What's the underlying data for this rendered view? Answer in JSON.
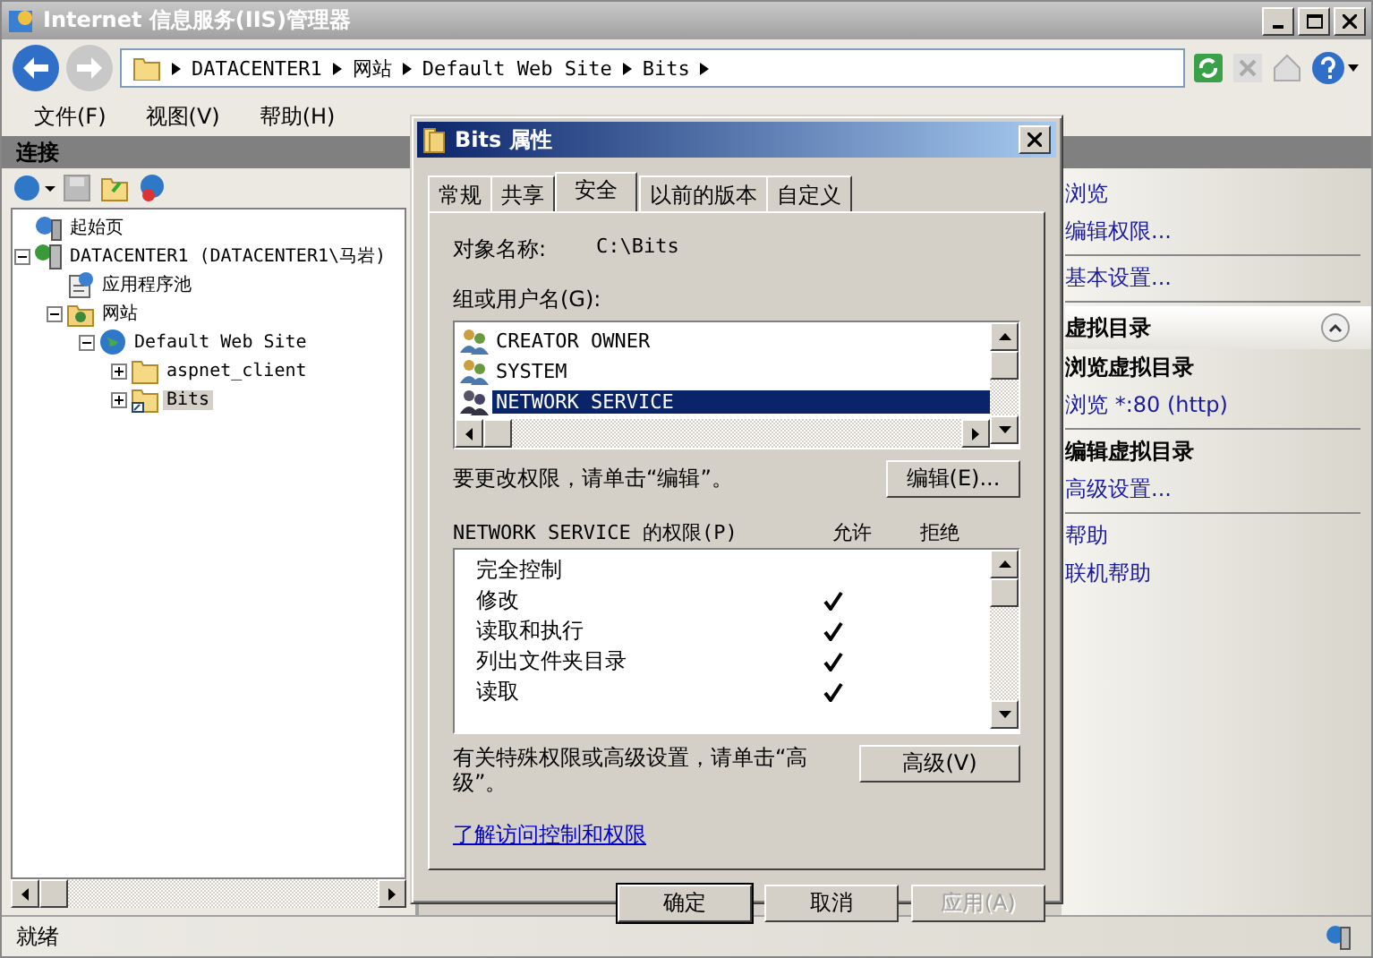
{
  "window": {
    "title": "Internet 信息服务(IIS)管理器"
  },
  "address_bar": {
    "segments": [
      "DATACENTER1",
      "网站",
      "Default Web Site",
      "Bits"
    ]
  },
  "menu": [
    "文件(F)",
    "视图(V)",
    "帮助(H)"
  ],
  "connections": {
    "title": "连接",
    "tree": [
      {
        "label": "起始页",
        "kind": "start",
        "selected": false
      },
      {
        "label": "DATACENTER1 (DATACENTER1\\马岩)",
        "kind": "server",
        "selected": false,
        "expanded": true,
        "children": [
          {
            "label": "应用程序池",
            "kind": "pool",
            "selected": false
          },
          {
            "label": "网站",
            "kind": "sites",
            "selected": false,
            "expanded": true,
            "children": [
              {
                "label": "Default Web Site",
                "kind": "site",
                "selected": false,
                "expanded": true,
                "children": [
                  {
                    "label": "aspnet_client",
                    "kind": "folder",
                    "selected": false,
                    "expanded": false
                  },
                  {
                    "label": "Bits",
                    "kind": "vfolder",
                    "selected": true,
                    "expanded": false
                  }
                ]
              }
            ]
          }
        ]
      }
    ]
  },
  "actions": [
    {
      "kind": "link",
      "text": "浏览"
    },
    {
      "kind": "link",
      "text": "编辑权限..."
    },
    {
      "kind": "divider"
    },
    {
      "kind": "link",
      "text": "基本设置..."
    },
    {
      "kind": "divider"
    },
    {
      "kind": "header",
      "text": "虚拟目录"
    },
    {
      "kind": "subheading",
      "text": "浏览虚拟目录"
    },
    {
      "kind": "link",
      "text": "浏览 *:80 (http)"
    },
    {
      "kind": "divider"
    },
    {
      "kind": "subheading",
      "text": "编辑虚拟目录"
    },
    {
      "kind": "link",
      "text": "高级设置..."
    },
    {
      "kind": "divider"
    },
    {
      "kind": "link",
      "text": "帮助"
    },
    {
      "kind": "link",
      "text": "联机帮助"
    }
  ],
  "dialog": {
    "title": "Bits 属性",
    "tabs": [
      {
        "label": "常规",
        "selected": false
      },
      {
        "label": "共享",
        "selected": false
      },
      {
        "label": "安全",
        "selected": true
      },
      {
        "label": "以前的版本",
        "selected": false
      },
      {
        "label": "自定义",
        "selected": false
      }
    ],
    "object_label": "对象名称:",
    "object_value": "C:\\Bits",
    "groups_label": "组或用户名(G):",
    "users": [
      {
        "name": "CREATOR OWNER",
        "selected": false
      },
      {
        "name": "SYSTEM",
        "selected": false
      },
      {
        "name": "NETWORK SERVICE",
        "selected": true
      }
    ],
    "edit_hint": "要更改权限，请单击“编辑”。",
    "edit_button": "编辑(E)...",
    "perms_label": "NETWORK SERVICE 的权限(P)",
    "allow_header": "允许",
    "deny_header": "拒绝",
    "permissions": [
      {
        "name": "完全控制",
        "allow": false,
        "deny": false
      },
      {
        "name": "修改",
        "allow": true,
        "deny": false
      },
      {
        "name": "读取和执行",
        "allow": true,
        "deny": false
      },
      {
        "name": "列出文件夹目录",
        "allow": true,
        "deny": false
      },
      {
        "name": "读取",
        "allow": true,
        "deny": false
      }
    ],
    "advanced_hint": "有关特殊权限或高级设置，请单击“高级”。",
    "advanced_button": "高级(V)",
    "link": "了解访问控制和权限",
    "buttons": [
      {
        "label": "确定",
        "default": true,
        "disabled": false
      },
      {
        "label": "取消",
        "default": false,
        "disabled": false
      },
      {
        "label": "应用(A)",
        "default": false,
        "disabled": true
      }
    ]
  },
  "status_bar": {
    "text": "就绪"
  }
}
